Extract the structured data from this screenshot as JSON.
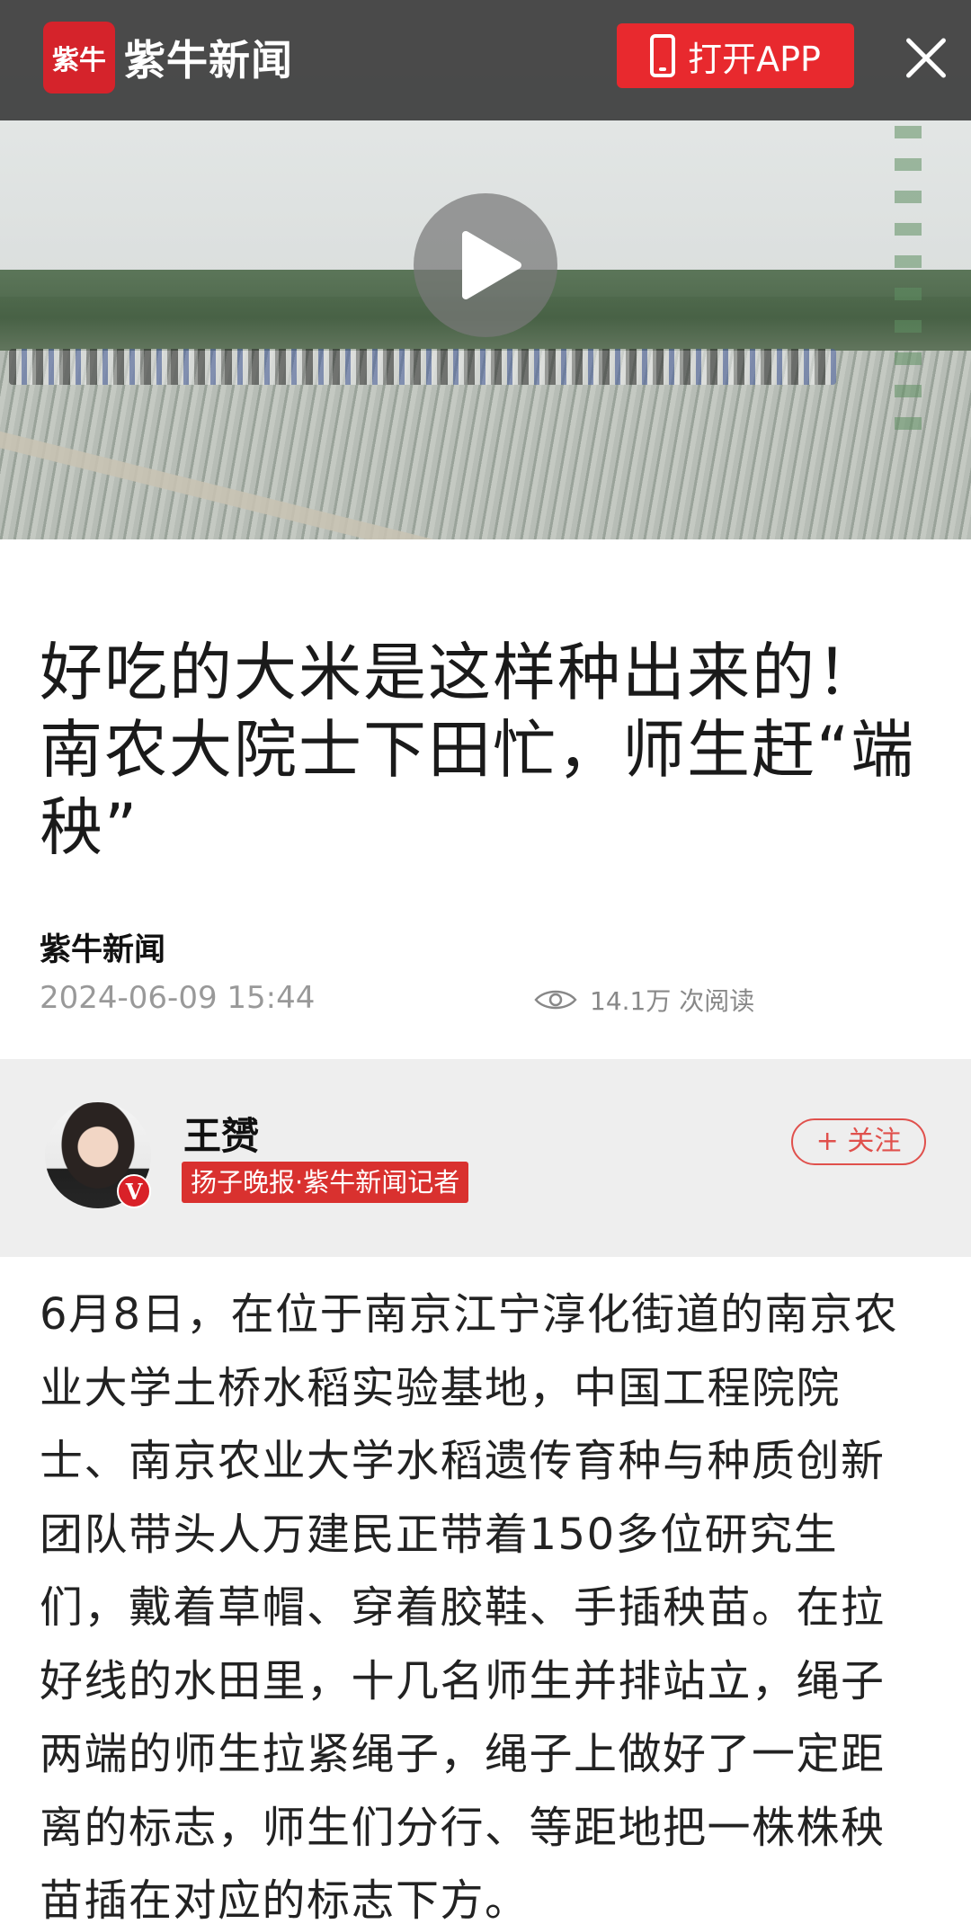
{
  "header": {
    "logo_mark": "紫牛",
    "logo_text": "紫牛新闻",
    "open_app_label": "打开APP"
  },
  "video": {
    "play_label": ""
  },
  "article": {
    "title_lines": [
      "好吃的大米是这样种出来的！",
      "南农大院士下田忙，师生赶“端",
      "秧”"
    ],
    "source": "紫牛新闻",
    "date": "2024-06-09 15:44",
    "views": "14.1万 次阅读",
    "body_lines": [
      "6月8日，在位于南京江宁淳化街道的南京农",
      "业大学土桥水稻实验基地，中国工程院院",
      "士、南京农业大学水稻遗传育种与种质创新",
      "团队带头人万建民正带着150多位研究生",
      "们，戴着草帽、穿着胶鞋、手插秧苗。在拉",
      "好线的水田里，十几名师生并排站立，绳子",
      "两端的师生拉紧绳子，绳子上做好了一定距",
      "离的标志，师生们分行、等距地把一株株秧",
      "苗插在对应的标志下方。"
    ]
  },
  "author": {
    "name": "王赟",
    "badge": "V",
    "title": "扬子晚报·紫牛新闻记者",
    "follow_label": "+ 关注"
  },
  "colors": {
    "brand_red": "#e8292e",
    "follow_red": "#e0504c",
    "author_bg": "#eeeeee"
  },
  "icons": [
    "phone-icon",
    "close-icon",
    "play-icon",
    "eye-icon",
    "verified-icon"
  ]
}
